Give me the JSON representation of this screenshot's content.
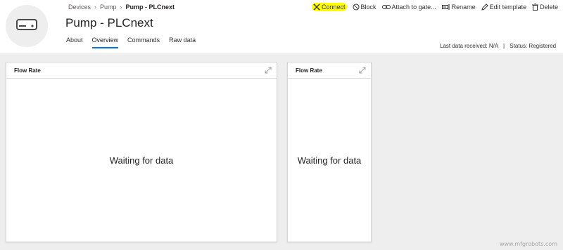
{
  "breadcrumb": {
    "items": [
      "Devices",
      "Pump"
    ],
    "current": "Pump - PLCnext"
  },
  "device": {
    "title": "Pump - PLCnext",
    "icon": "device-box-icon"
  },
  "tabs": [
    {
      "label": "About",
      "active": false
    },
    {
      "label": "Overview",
      "active": true
    },
    {
      "label": "Commands",
      "active": false
    },
    {
      "label": "Raw data",
      "active": false
    }
  ],
  "toolbar": {
    "connect": "Connect",
    "block": "Block",
    "attach": "Attach to gate...",
    "rename": "Rename",
    "edit_template": "Edit template",
    "delete": "Delete"
  },
  "status": {
    "last_data": "Last data received: N/A",
    "separator": "|",
    "status": "Status: Registered"
  },
  "tiles": [
    {
      "title": "Flow Rate",
      "message": "Waiting for data"
    },
    {
      "title": "Flow Rate",
      "message": "Waiting for data"
    }
  ],
  "watermark": "www.mfgrobots.com",
  "colors": {
    "accent": "#0078d4",
    "highlight": "#ffff00",
    "canvas": "#eeeeee"
  }
}
